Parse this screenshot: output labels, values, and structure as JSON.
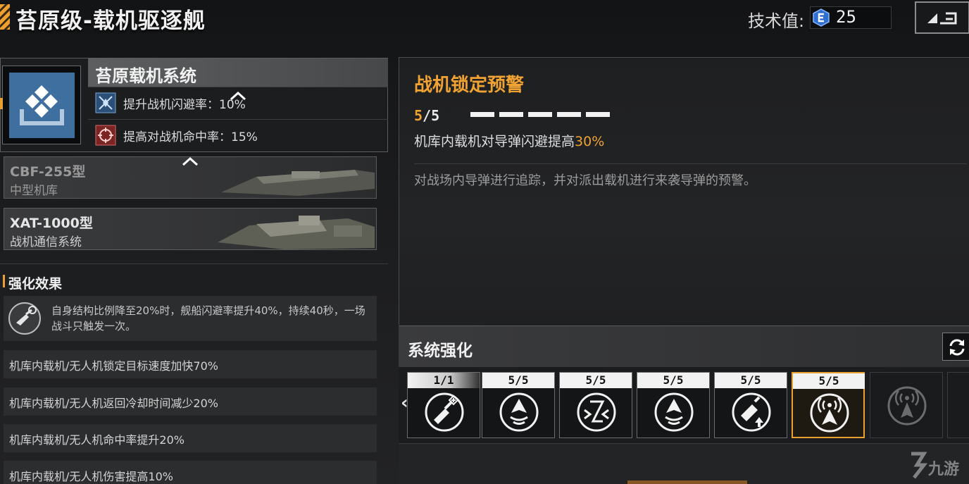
{
  "header": {
    "title": "苔原级-载机驱逐舰",
    "tech_label": "技术值:",
    "tech_value": "25",
    "back_icon": "back-arrow-icon"
  },
  "system": {
    "title": "苔原载机系统",
    "icon": "carrier-system-icon",
    "stats": [
      {
        "icon": "evasion-icon",
        "text": "提升战机闪避率：10%"
      },
      {
        "icon": "target-icon",
        "text": "提高对战机命中率：15%"
      }
    ]
  },
  "modules": [
    {
      "name": "CBF-255型",
      "type": "中型机库"
    },
    {
      "name": "XAT-1000型",
      "type": "战机通信系统"
    }
  ],
  "enhance_effects": {
    "title": "强化效果",
    "main": "自身结构比例降至20%时，舰船闪避率提升40%，持续40秒，一场战斗只触发一次。",
    "rows": [
      "机库内载机/无人机锁定目标速度加快70%",
      "机库内载机/无人机返回冷却时间减少20%",
      "机库内载机/无人机命中率提升20%",
      "机库内载机/无人机伤害提高10%"
    ]
  },
  "detail": {
    "title": "战机锁定预警",
    "level_current": "5",
    "level_max": "/5",
    "level_fraction": 1.0,
    "effect_prefix": "机库内载机对导弹闪避提高",
    "effect_value": "30%",
    "description": "对战场内导弹进行追踪，并对派出载机进行来袭导弹的预警。"
  },
  "system_enhance": {
    "title": "系统强化",
    "refresh_icon": "refresh-icon",
    "slots": [
      {
        "level": "1/1",
        "icon": "fighter-boost-icon"
      },
      {
        "level": "5/5",
        "icon": "fighter-wave-icon"
      },
      {
        "level": "5/5",
        "icon": "cooldown-icon"
      },
      {
        "level": "5/5",
        "icon": "fighter-wave-icon"
      },
      {
        "level": "5/5",
        "icon": "damage-up-icon"
      },
      {
        "level": "5/5",
        "icon": "radar-fighter-icon"
      },
      {
        "level": "",
        "icon": "radar-locked-icon"
      }
    ]
  },
  "watermark": {
    "text": "九游",
    "icon": "jiuyou-logo-icon"
  },
  "colors": {
    "accent": "#f0a232",
    "selected_border": "#e8a030",
    "system_icon_bg": "#3e6f9f"
  }
}
